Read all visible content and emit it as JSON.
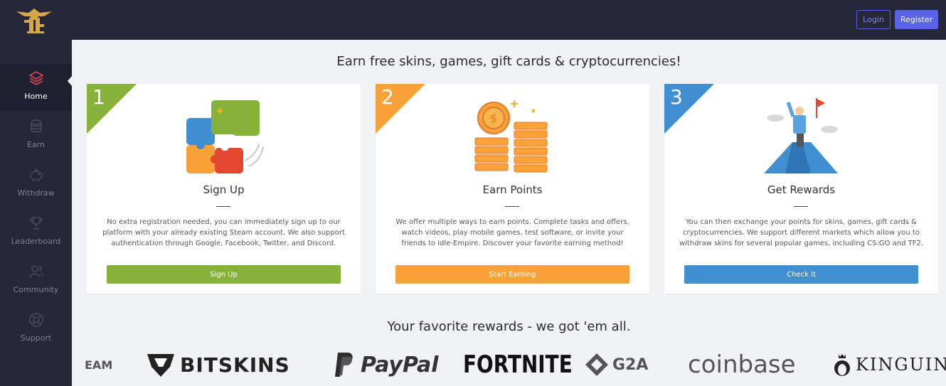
{
  "header": {
    "login_label": "Login",
    "register_label": "Register"
  },
  "sidebar": {
    "items": [
      {
        "label": "Home",
        "icon": "layers-icon"
      },
      {
        "label": "Earn",
        "icon": "coins-icon"
      },
      {
        "label": "Withdraw",
        "icon": "piggy-bank-icon"
      },
      {
        "label": "Leaderboard",
        "icon": "trophy-icon"
      },
      {
        "label": "Community",
        "icon": "users-icon"
      },
      {
        "label": "Support",
        "icon": "lifebuoy-icon"
      }
    ]
  },
  "main": {
    "headline": "Earn free skins, games, gift cards & cryptocurrencies!",
    "rewards_headline": "Your favorite rewards - we got 'em all."
  },
  "cards": [
    {
      "number": "1",
      "title": "Sign Up",
      "description": "No extra registration needed, you can immediately sign up to our platform with your already existing Steam account. We also support authentication through Google, Facebook, Twitter, and Discord.",
      "button": "Sign Up",
      "color": "#86b23a",
      "icon": "puzzle-icon"
    },
    {
      "number": "2",
      "title": "Earn Points",
      "description": "We offer multiple ways to earn points. Complete tasks and offers, watch videos, play mobile games, test software, or invite your friends to Idle-Empire. Discover your favorite earning method!",
      "button": "Start Earning",
      "color": "#f9a23a",
      "icon": "coin-stacks-icon"
    },
    {
      "number": "3",
      "title": "Get Rewards",
      "description": "You can then exchange your points for skins, games, gift cards & cryptocurrencies. We support different markets which allow you to withdraw skins for several popular games, including CS:GO and TF2.",
      "button": "Check It",
      "color": "#3f8fd1",
      "icon": "mountain-summit-icon"
    }
  ],
  "brands": [
    "EAM",
    "BITSKINS",
    "PayPal",
    "FORTNITE",
    "G2A",
    "coinbase",
    "KINGUIN"
  ]
}
